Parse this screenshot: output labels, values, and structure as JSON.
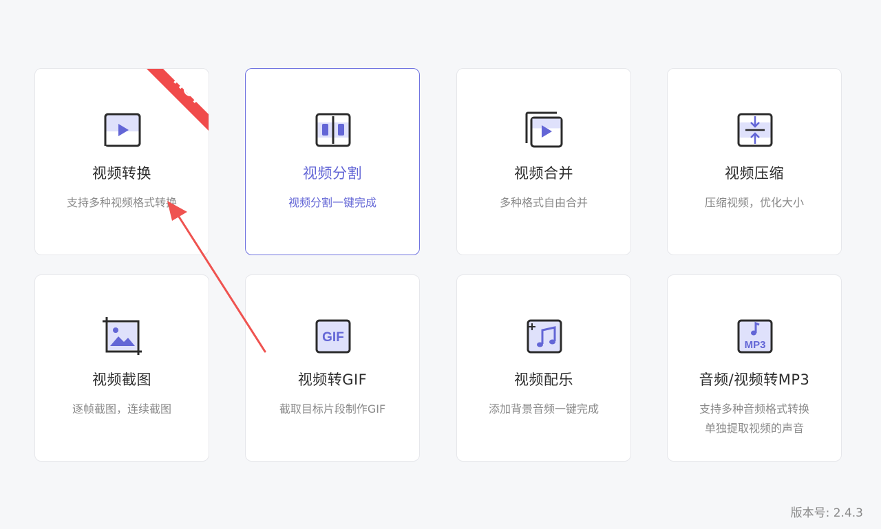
{
  "colors": {
    "accent": "#6366d6",
    "icon_fill": "#dfe1fb",
    "icon_stroke": "#2b2b2b",
    "hot": "#f04b4b"
  },
  "cards": [
    {
      "title": "视频转换",
      "desc": [
        "支持多种视频格式转换"
      ],
      "icon": "video-convert-icon",
      "badge": "HOT",
      "active": false
    },
    {
      "title": "视频分割",
      "desc": [
        "视频分割一键完成"
      ],
      "icon": "video-split-icon",
      "active": true
    },
    {
      "title": "视频合并",
      "desc": [
        "多种格式自由合并"
      ],
      "icon": "video-merge-icon",
      "active": false
    },
    {
      "title": "视频压缩",
      "desc": [
        "压缩视频，优化大小"
      ],
      "icon": "video-compress-icon",
      "active": false
    },
    {
      "title": "视频截图",
      "desc": [
        "逐帧截图，连续截图"
      ],
      "icon": "screenshot-icon",
      "active": false
    },
    {
      "title": "视频转GIF",
      "desc": [
        "截取目标片段制作GIF"
      ],
      "icon": "gif-icon",
      "icon_text": "GIF",
      "active": false
    },
    {
      "title": "视频配乐",
      "desc": [
        "添加背景音频一键完成"
      ],
      "icon": "add-music-icon",
      "active": false
    },
    {
      "title": "音频/视频转MP3",
      "desc": [
        "支持多种音频格式转换",
        "单独提取视频的声音"
      ],
      "icon": "mp3-icon",
      "icon_text": "MP3",
      "active": false
    }
  ],
  "version_label": "版本号: 2.4.3"
}
